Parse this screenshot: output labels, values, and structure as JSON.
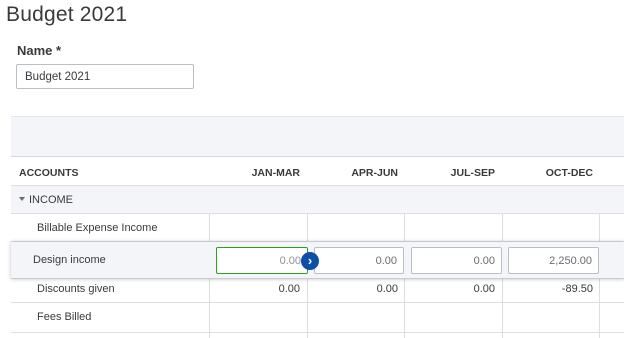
{
  "page": {
    "title": "Budget 2021"
  },
  "name_field": {
    "label": "Name *",
    "value": "Budget 2021"
  },
  "table": {
    "headers": {
      "accounts": "ACCOUNTS",
      "q1": "JAN-MAR",
      "q2": "APR-JUN",
      "q3": "JUL-SEP",
      "q4": "OCT-DEC"
    },
    "section": {
      "label": "INCOME"
    },
    "rows": [
      {
        "account": "Billable Expense Income",
        "q1": "",
        "q2": "",
        "q3": "",
        "q4": ""
      },
      {
        "account": "Design income",
        "q1": "0.00",
        "q2": "0.00",
        "q3": "0.00",
        "q4": "2,250.00"
      },
      {
        "account": "Discounts given",
        "q1": "0.00",
        "q2": "0.00",
        "q3": "0.00",
        "q4": "-89.50"
      },
      {
        "account": "Fees Billed",
        "q1": "",
        "q2": "",
        "q3": "",
        "q4": ""
      }
    ]
  },
  "icons": {
    "expand_arrow": "chevron-right-icon",
    "collapse_caret": "caret-down-icon"
  },
  "colors": {
    "focus_border": "#2ca01c",
    "arrow_button": "#0d4ea6"
  }
}
